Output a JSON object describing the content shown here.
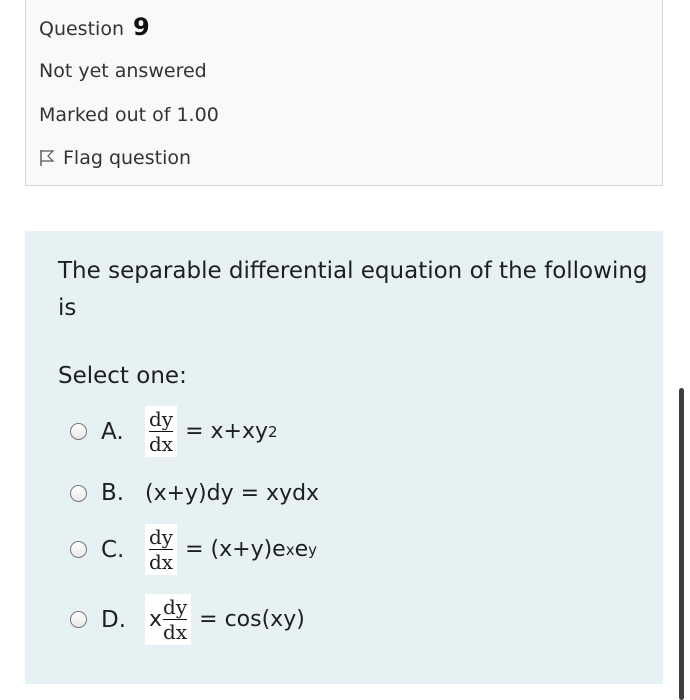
{
  "info": {
    "question_word": "Question",
    "question_number": "9",
    "status": "Not yet answered",
    "marks": "Marked out of 1.00",
    "flag_label": "Flag question"
  },
  "question": {
    "text": "The separable differential equation of the following is",
    "prompt": "Select one:"
  },
  "options": [
    {
      "letter": "A.",
      "num": "dy",
      "den": "dx",
      "prefix": "",
      "rhs": "= x+xy",
      "sup": "2",
      "tail": ""
    },
    {
      "letter": "B.",
      "text": "(x+y)dy = xydx"
    },
    {
      "letter": "C.",
      "num": "dy",
      "den": "dx",
      "prefix": "",
      "rhs": "= (x+y)e",
      "sup": "x",
      "tail": "e",
      "sup2": "y"
    },
    {
      "letter": "D.",
      "num": "dy",
      "den": "dx",
      "prefix": "x",
      "rhs": "= cos(xy)"
    }
  ]
}
